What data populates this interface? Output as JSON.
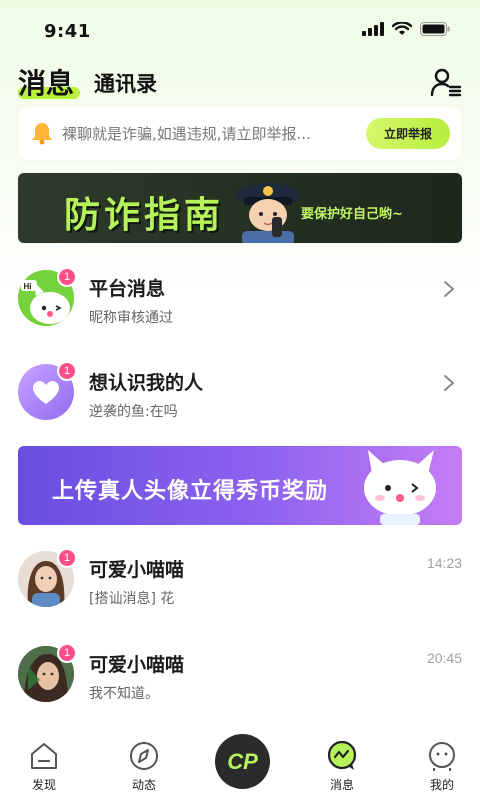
{
  "status_bar": {
    "time": "9:41"
  },
  "header": {
    "tab_messages": "消息",
    "tab_contacts": "通讯录",
    "accent": "#b8f03a"
  },
  "notice": {
    "text": "裸聊就是诈骗,如遇违规,请立即举报...",
    "button_label": "立即举报"
  },
  "fraud_banner": {
    "title": "防诈指南",
    "subtitle": "要保护好自己哟~"
  },
  "items": [
    {
      "title": "平台消息",
      "subtitle": "昵称审核通过",
      "badge": "1"
    },
    {
      "title": "想认识我的人",
      "subtitle": "逆袭的鱼:在吗",
      "badge": "1"
    }
  ],
  "upload_banner": {
    "text": "上传真人头像立得秀币奖励"
  },
  "chats": [
    {
      "name": "可爱小喵喵",
      "preview": "[搭讪消息] 花",
      "time": "14:23",
      "badge": "1"
    },
    {
      "name": "可爱小喵喵",
      "preview": "我不知道。",
      "time": "20:45",
      "badge": "1"
    }
  ],
  "bottom_nav": {
    "discover": "发现",
    "moments": "动态",
    "center": "CP",
    "messages": "消息",
    "mine": "我的"
  }
}
